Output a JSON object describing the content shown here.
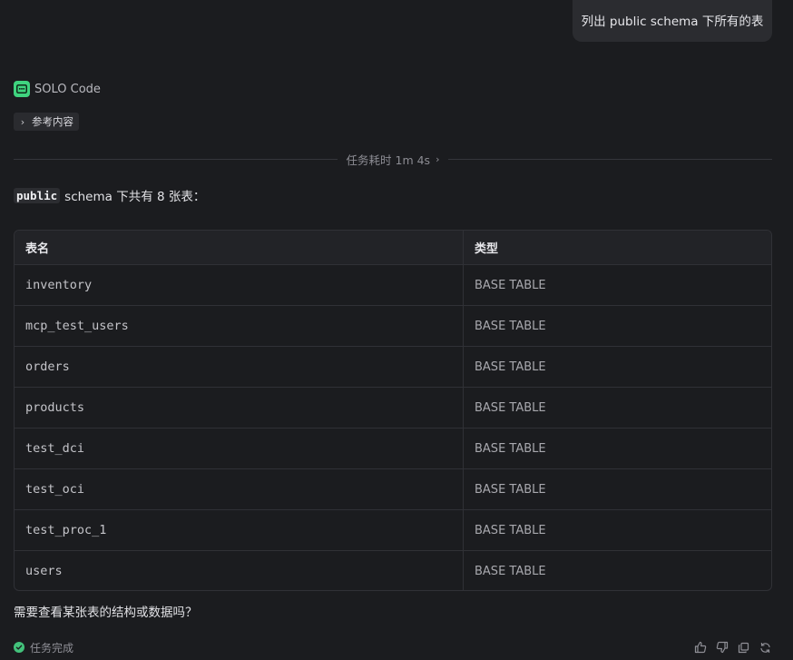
{
  "user_message": "列出 public schema 下所有的表",
  "assistant": {
    "name": "SOLO Code",
    "reference_label": "参考内容"
  },
  "task": {
    "duration_label": "任务耗时 1m 4s"
  },
  "intro": {
    "code": "public",
    "text": "schema 下共有 8 张表："
  },
  "table": {
    "headers": [
      "表名",
      "类型"
    ],
    "rows": [
      {
        "name": "inventory",
        "type": "BASE TABLE"
      },
      {
        "name": "mcp_test_users",
        "type": "BASE TABLE"
      },
      {
        "name": "orders",
        "type": "BASE TABLE"
      },
      {
        "name": "products",
        "type": "BASE TABLE"
      },
      {
        "name": "test_dci",
        "type": "BASE TABLE"
      },
      {
        "name": "test_oci",
        "type": "BASE TABLE"
      },
      {
        "name": "test_proc_1",
        "type": "BASE TABLE"
      },
      {
        "name": "users",
        "type": "BASE TABLE"
      }
    ]
  },
  "question": "需要查看某张表的结构或数据吗？",
  "footer": {
    "status": "任务完成",
    "actions": [
      "thumbs-up-icon",
      "thumbs-down-icon",
      "copy-icon",
      "refresh-icon"
    ]
  },
  "colors": {
    "background": "#1b1c1f",
    "accent_green": "#3fd47f"
  }
}
